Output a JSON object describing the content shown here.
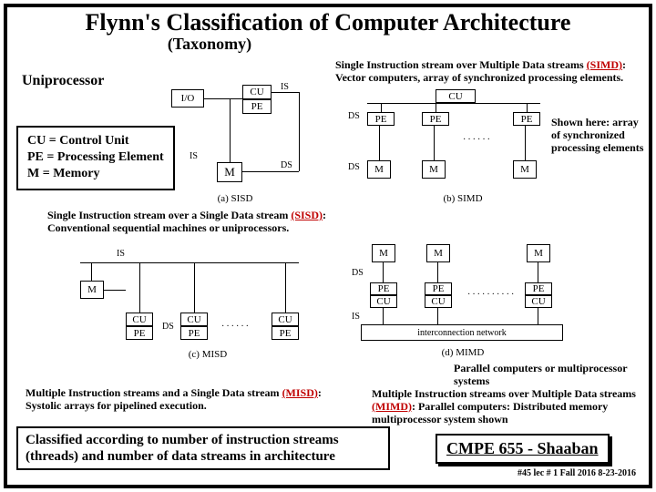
{
  "title": "Flynn's Classification of Computer Architecture",
  "subtitle": "(Taxonomy)",
  "uniprocessor": "Uniprocessor",
  "simd_desc1": "Single Instruction stream over Multiple Data streams ",
  "simd_abbr": "(SIMD)",
  "simd_desc2": ": Vector computers, array of synchronized processing elements.",
  "shown_here": "Shown here: array of synchronized processing elements",
  "legend": {
    "cu": "CU = Control Unit",
    "pe": "PE = Processing Element",
    "m": "M = Memory"
  },
  "sisd_desc1": "Single Instruction stream over a Single Data stream ",
  "sisd_abbr": "(SISD)",
  "sisd_desc2": ": Conventional sequential machines or uniprocessors.",
  "misd_desc1": "Multiple Instruction streams and a Single Data stream ",
  "misd_abbr": "(MISD)",
  "misd_desc2": ": Systolic arrays for pipelined execution.",
  "parallel_note": "Parallel computers or multiprocessor systems",
  "mimd_desc1": "Multiple Instruction streams over Multiple Data streams ",
  "mimd_abbr": "(MIMD)",
  "mimd_desc2": ": Parallel computers: Distributed memory multiprocessor system shown",
  "classified": "Classified according to number of instruction streams (threads) and number of data streams in architecture",
  "course": "CMPE 655 - Shaaban",
  "footer_meta": "#45  lec # 1   Fall 2016   8-23-2016",
  "labels": {
    "IS": "IS",
    "DS": "DS",
    "IO": "I/O",
    "CU": "CU",
    "PE": "PE",
    "M": "M",
    "cap_a": "(a) SISD",
    "cap_b": "(b) SIMD",
    "cap_c": "(c) MISD",
    "cap_d": "(d) MIMD",
    "intercon": "interconnection network"
  }
}
